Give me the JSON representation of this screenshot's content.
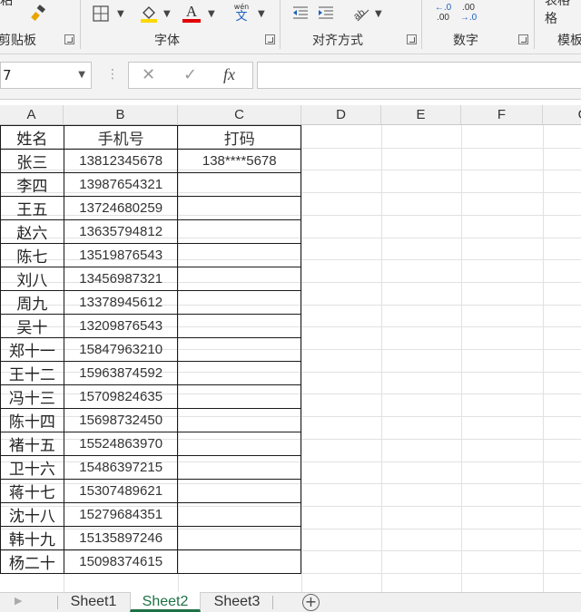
{
  "ribbon": {
    "groups": {
      "clipboard": "剪贴板",
      "font": "字体",
      "alignment": "对齐方式",
      "number": "数字",
      "styles": "模板"
    },
    "icons": {
      "format_painter": "paintbrush-icon",
      "borders": "border-grid-icon",
      "fill_color": "fill-bucket-icon",
      "font_color": "font-color-icon",
      "phonetic": "phonetic-guide-icon",
      "decrease_indent": "decrease-indent-icon",
      "increase_indent": "increase-indent-icon",
      "orientation": "text-orientation-icon",
      "increase_decimal": "increase-decimal-icon",
      "decrease_decimal": "decrease-decimal-icon"
    },
    "phonetic_top": "wén",
    "phonetic_bottom": "文",
    "font_color_letter": "A",
    "inc_decimal_top": "←.0",
    "inc_decimal_bottom": ".00",
    "dec_decimal_top": ".00",
    "dec_decimal_bottom": "→.0",
    "colors": {
      "fill": "#ffd800",
      "font": "#e00000"
    }
  },
  "formula_bar": {
    "name_box": "7",
    "fx_label": "fx"
  },
  "columns": [
    "A",
    "B",
    "C",
    "D",
    "E",
    "F",
    "G"
  ],
  "table": {
    "headers": [
      "姓名",
      "手机号",
      "打码"
    ],
    "rows": [
      [
        "张三",
        "13812345678",
        "138****5678"
      ],
      [
        "李四",
        "13987654321",
        ""
      ],
      [
        "王五",
        "13724680259",
        ""
      ],
      [
        "赵六",
        "13635794812",
        ""
      ],
      [
        "陈七",
        "13519876543",
        ""
      ],
      [
        "刘八",
        "13456987321",
        ""
      ],
      [
        "周九",
        "13378945612",
        ""
      ],
      [
        "吴十",
        "13209876543",
        ""
      ],
      [
        "郑十一",
        "15847963210",
        ""
      ],
      [
        "王十二",
        "15963874592",
        ""
      ],
      [
        "冯十三",
        "15709824635",
        ""
      ],
      [
        "陈十四",
        "15698732450",
        ""
      ],
      [
        "褚十五",
        "15524863970",
        ""
      ],
      [
        "卫十六",
        "15486397215",
        ""
      ],
      [
        "蒋十七",
        "15307489621",
        ""
      ],
      [
        "沈十八",
        "15279684351",
        ""
      ],
      [
        "韩十九",
        "15135897246",
        ""
      ],
      [
        "杨二十",
        "15098374615",
        ""
      ]
    ]
  },
  "sheets": [
    "Sheet1",
    "Sheet2",
    "Sheet3"
  ],
  "active_sheet": "Sheet2",
  "accent_color": "#1e7145"
}
